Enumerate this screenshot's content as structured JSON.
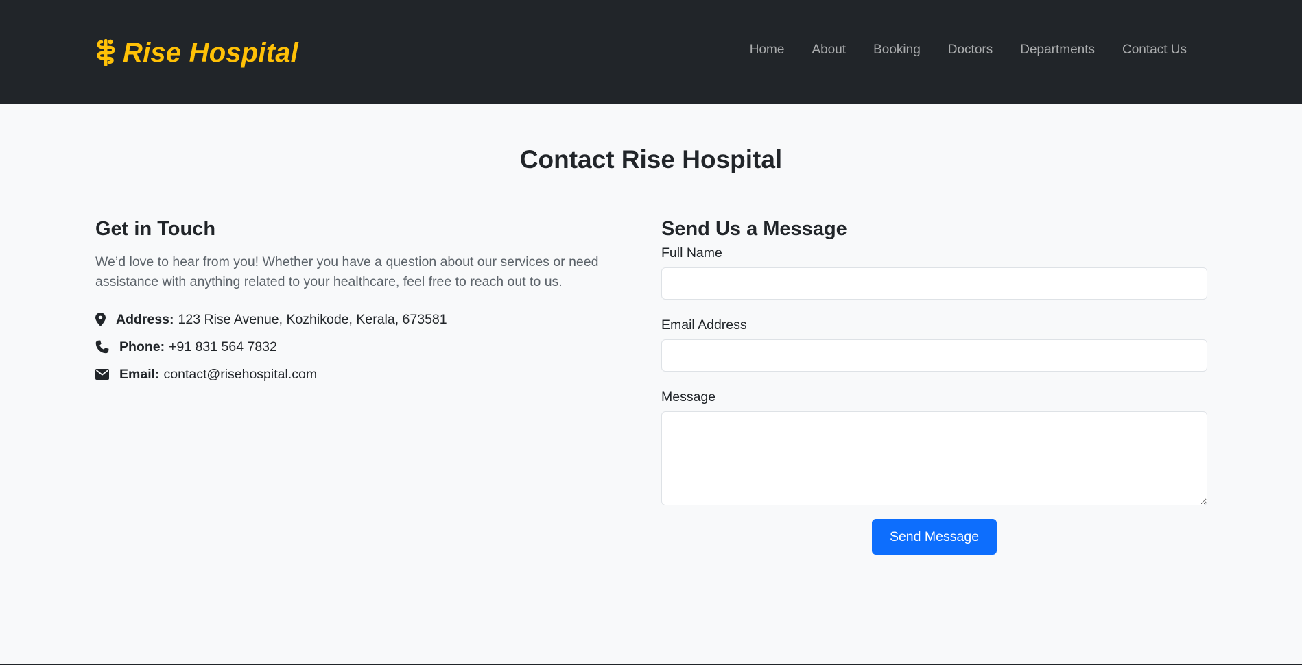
{
  "brand": {
    "name": "Rise Hospital",
    "icon": "staff-of-aesculapius-icon",
    "color": "#ffc107"
  },
  "nav": {
    "items": [
      {
        "label": "Home"
      },
      {
        "label": "About"
      },
      {
        "label": "Booking"
      },
      {
        "label": "Doctors"
      },
      {
        "label": "Departments"
      },
      {
        "label": "Contact Us"
      }
    ]
  },
  "page": {
    "title": "Contact Rise Hospital"
  },
  "get_in_touch": {
    "heading": "Get in Touch",
    "intro": "We’d love to hear from you! Whether you have a question about our services or need assistance with anything related to your healthcare, feel free to reach out to us.",
    "address": {
      "icon": "map-marker-icon",
      "label": "Address:",
      "value": "123 Rise Avenue, Kozhikode, Kerala, 673581"
    },
    "phone": {
      "icon": "phone-icon",
      "label": "Phone:",
      "value": "+91 831 564 7832"
    },
    "email": {
      "icon": "envelope-icon",
      "label": "Email:",
      "value": "contact@risehospital.com"
    }
  },
  "form": {
    "heading": "Send Us a Message",
    "full_name": {
      "label": "Full Name",
      "value": "",
      "placeholder": ""
    },
    "email": {
      "label": "Email Address",
      "value": "",
      "placeholder": ""
    },
    "message": {
      "label": "Message",
      "value": "",
      "placeholder": ""
    },
    "submit_label": "Send Message"
  },
  "colors": {
    "navbar_bg": "#212529",
    "page_bg": "#f8f9fa",
    "accent": "#ffc107",
    "primary": "#0d6efd"
  }
}
